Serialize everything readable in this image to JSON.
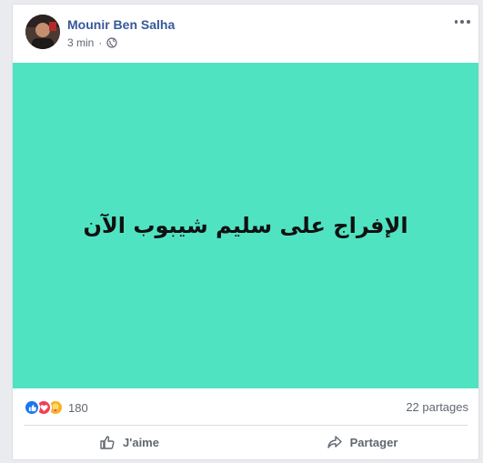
{
  "post": {
    "author": "Mounir Ben Salha",
    "time": "3 min",
    "privacy_icon": "globe-icon",
    "more_icon": "more-options-icon",
    "content_text": "الإفراج على سليم شيبوب الآن",
    "background_color": "#50e3c2"
  },
  "stats": {
    "reaction_icons": [
      "like-icon",
      "love-icon",
      "care-icon"
    ],
    "reactions_count": "180",
    "shares": "22 partages"
  },
  "actions": {
    "like_label": "J'aime",
    "share_label": "Partager"
  }
}
